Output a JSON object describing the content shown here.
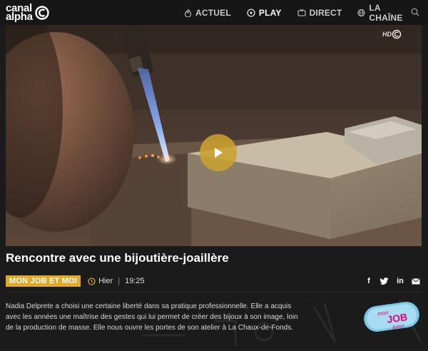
{
  "header": {
    "logo_line1": "canal",
    "logo_line2": "alpha",
    "nav": [
      {
        "label": "ACTUEL",
        "icon": "flame-icon"
      },
      {
        "label": "PLAY",
        "icon": "play-circle-icon",
        "active": true
      },
      {
        "label": "DIRECT",
        "icon": "tv-icon"
      },
      {
        "label": "LA CHAÎNE",
        "icon": "globe-icon"
      }
    ],
    "search_icon": "search-icon"
  },
  "video": {
    "hd_label": "HD",
    "play_icon": "play-icon"
  },
  "article": {
    "title": "Rencontre avec une bijoutière-joaillère",
    "tag": "MON JOB ET MOI",
    "date": "Hier",
    "separator": "|",
    "time": "19:25",
    "description": "Nadia Delprete a choisi une certaine liberté dans sa pratique professionnelle. Elle a acquis avec les années une maîtrise des gestes qui lui permet de créer des bijoux à son image, loin de la production de masse. Elle nous ouvre les portes de son atelier à La Chaux-de-Fonds.",
    "share": [
      {
        "icon": "facebook-icon",
        "glyph": "f"
      },
      {
        "icon": "twitter-icon",
        "glyph": ""
      },
      {
        "icon": "linkedin-icon",
        "glyph": "in"
      },
      {
        "icon": "mail-icon",
        "glyph": ""
      }
    ],
    "show_logo": {
      "line1": "mon",
      "line2": "JOB",
      "line3": "&moi"
    }
  },
  "colors": {
    "accent": "#e0a92a",
    "background": "#1b1b1b",
    "header": "#161616"
  }
}
